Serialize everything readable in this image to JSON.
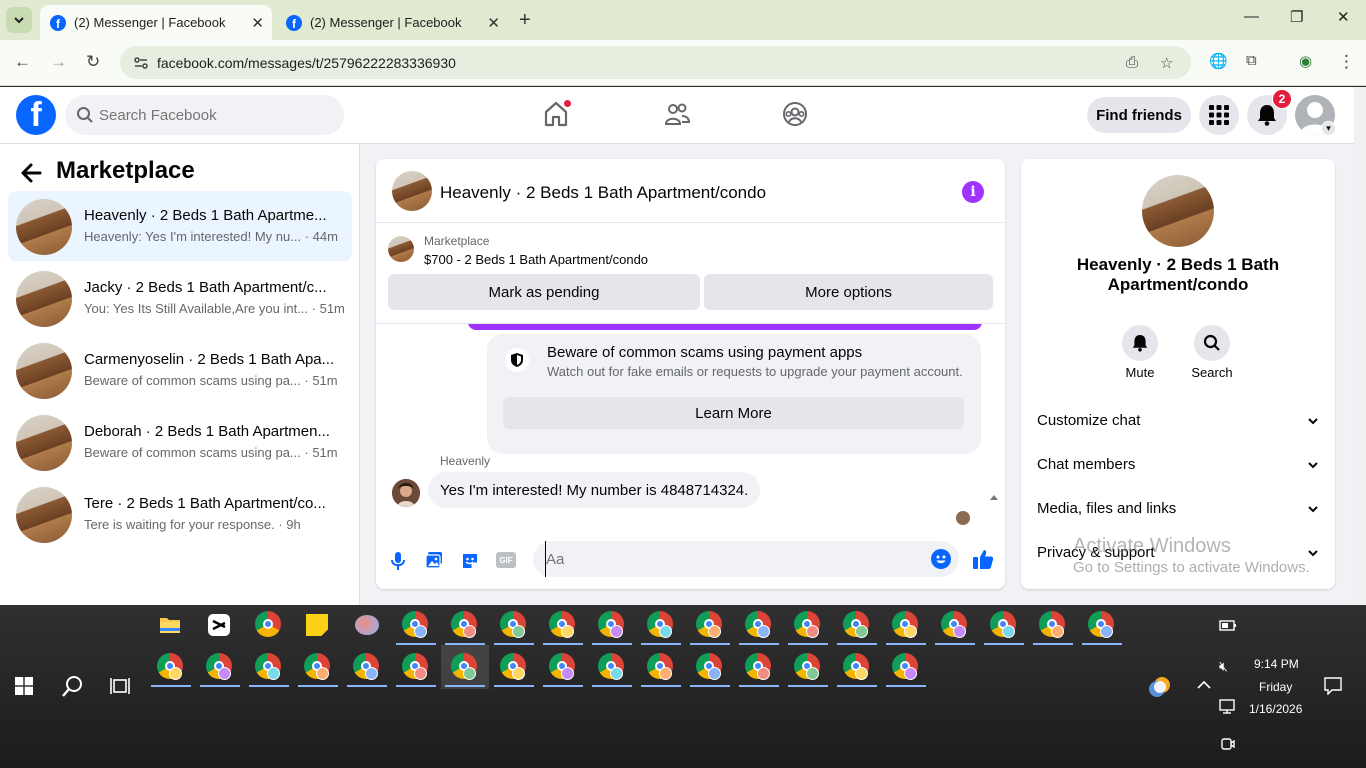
{
  "browser": {
    "tabs": [
      {
        "title": "(2) Messenger | Facebook",
        "active": true
      },
      {
        "title": "(2) Messenger | Facebook",
        "active": false
      }
    ],
    "url": "facebook.com/messages/t/25796222283336930"
  },
  "fb": {
    "logo": "f",
    "search_placeholder": "Search Facebook",
    "find_friends": "Find friends",
    "notif_count": "2"
  },
  "sidebar": {
    "title": "Marketplace",
    "conversations": [
      {
        "name": "Heavenly · 2 Beds 1 Bath Apartme...",
        "preview": "Heavenly: Yes I'm interested! My nu... · 44m",
        "active": true
      },
      {
        "name": "Jacky · 2 Beds 1 Bath Apartment/c...",
        "preview": "You: Yes Its Still Available,Are you int... · 51m",
        "active": false
      },
      {
        "name": "Carmenyoselin · 2 Beds 1 Bath Apa...",
        "preview": "Beware of common scams using pa... · 51m",
        "active": false
      },
      {
        "name": "Deborah · 2 Beds 1 Bath Apartmen...",
        "preview": "Beware of common scams using pa... · 51m",
        "active": false
      },
      {
        "name": "Tere · 2 Beds 1 Bath Apartment/co...",
        "preview": "Tere is waiting for your response. · 9h",
        "active": false
      }
    ]
  },
  "chat": {
    "title": "Heavenly · 2 Beds 1 Bath Apartment/condo",
    "marketplace_label": "Marketplace",
    "listing": "$700 - 2 Beds 1 Bath Apartment/condo",
    "mark_pending": "Mark as pending",
    "more_options": "More options",
    "scam_title": "Beware of common scams using payment apps",
    "scam_sub": "Watch out for fake emails or requests to upgrade your payment account.",
    "learn_more": "Learn More",
    "sender": "Heavenly",
    "message": "Yes I'm interested! My number is 4848714324.",
    "input_placeholder": "Aa",
    "gif": "GIF"
  },
  "info": {
    "name": "Heavenly · 2 Beds 1 Bath Apartment/condo",
    "mute": "Mute",
    "search": "Search",
    "sections": [
      "Customize chat",
      "Chat members",
      "Media, files and links",
      "Privacy & support"
    ]
  },
  "watermark": {
    "line1": "Activate Windows",
    "line2": "Go to Settings to activate Windows."
  },
  "tray": {
    "time": "9:14 PM",
    "day": "Friday",
    "date": "1/16/2026"
  },
  "colors": {
    "fb_blue": "#0866ff",
    "accent_purple": "#a033ff",
    "badge_red": "#e41e3f"
  }
}
